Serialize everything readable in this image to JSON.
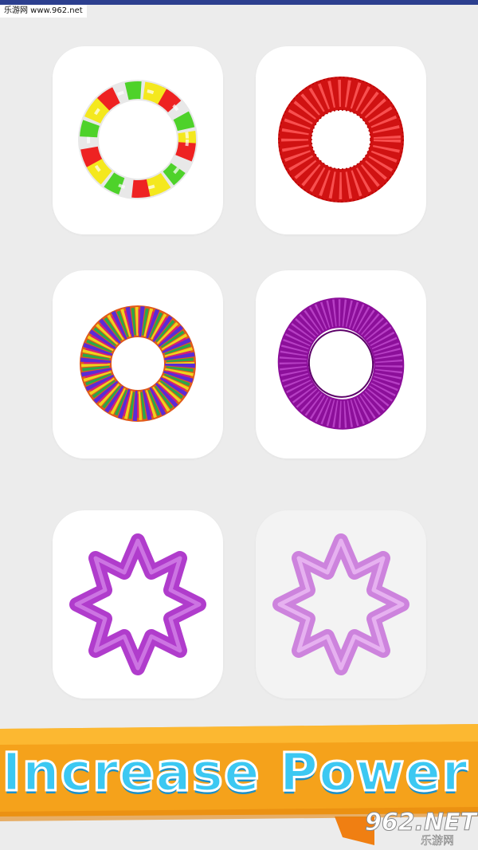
{
  "watermark_top": "乐游网 www.962.net",
  "tiles": [
    {
      "name": "twisted-candy-ring",
      "dim": false
    },
    {
      "name": "red-mesh-torus",
      "dim": false
    },
    {
      "name": "rainbow-twist-torus",
      "dim": false
    },
    {
      "name": "purple-loop-torus",
      "dim": false
    },
    {
      "name": "purple-star-ring",
      "dim": false
    },
    {
      "name": "pink-star-ring",
      "dim": true
    }
  ],
  "banner": {
    "text": "Increase Power"
  },
  "watermark_bottom": {
    "site": "962.NET",
    "cn": "乐游网"
  },
  "colors": {
    "background": "#ececec",
    "tile": "#ffffff",
    "banner_orange": "#f5a21b",
    "banner_text": "#3cc8f2"
  }
}
